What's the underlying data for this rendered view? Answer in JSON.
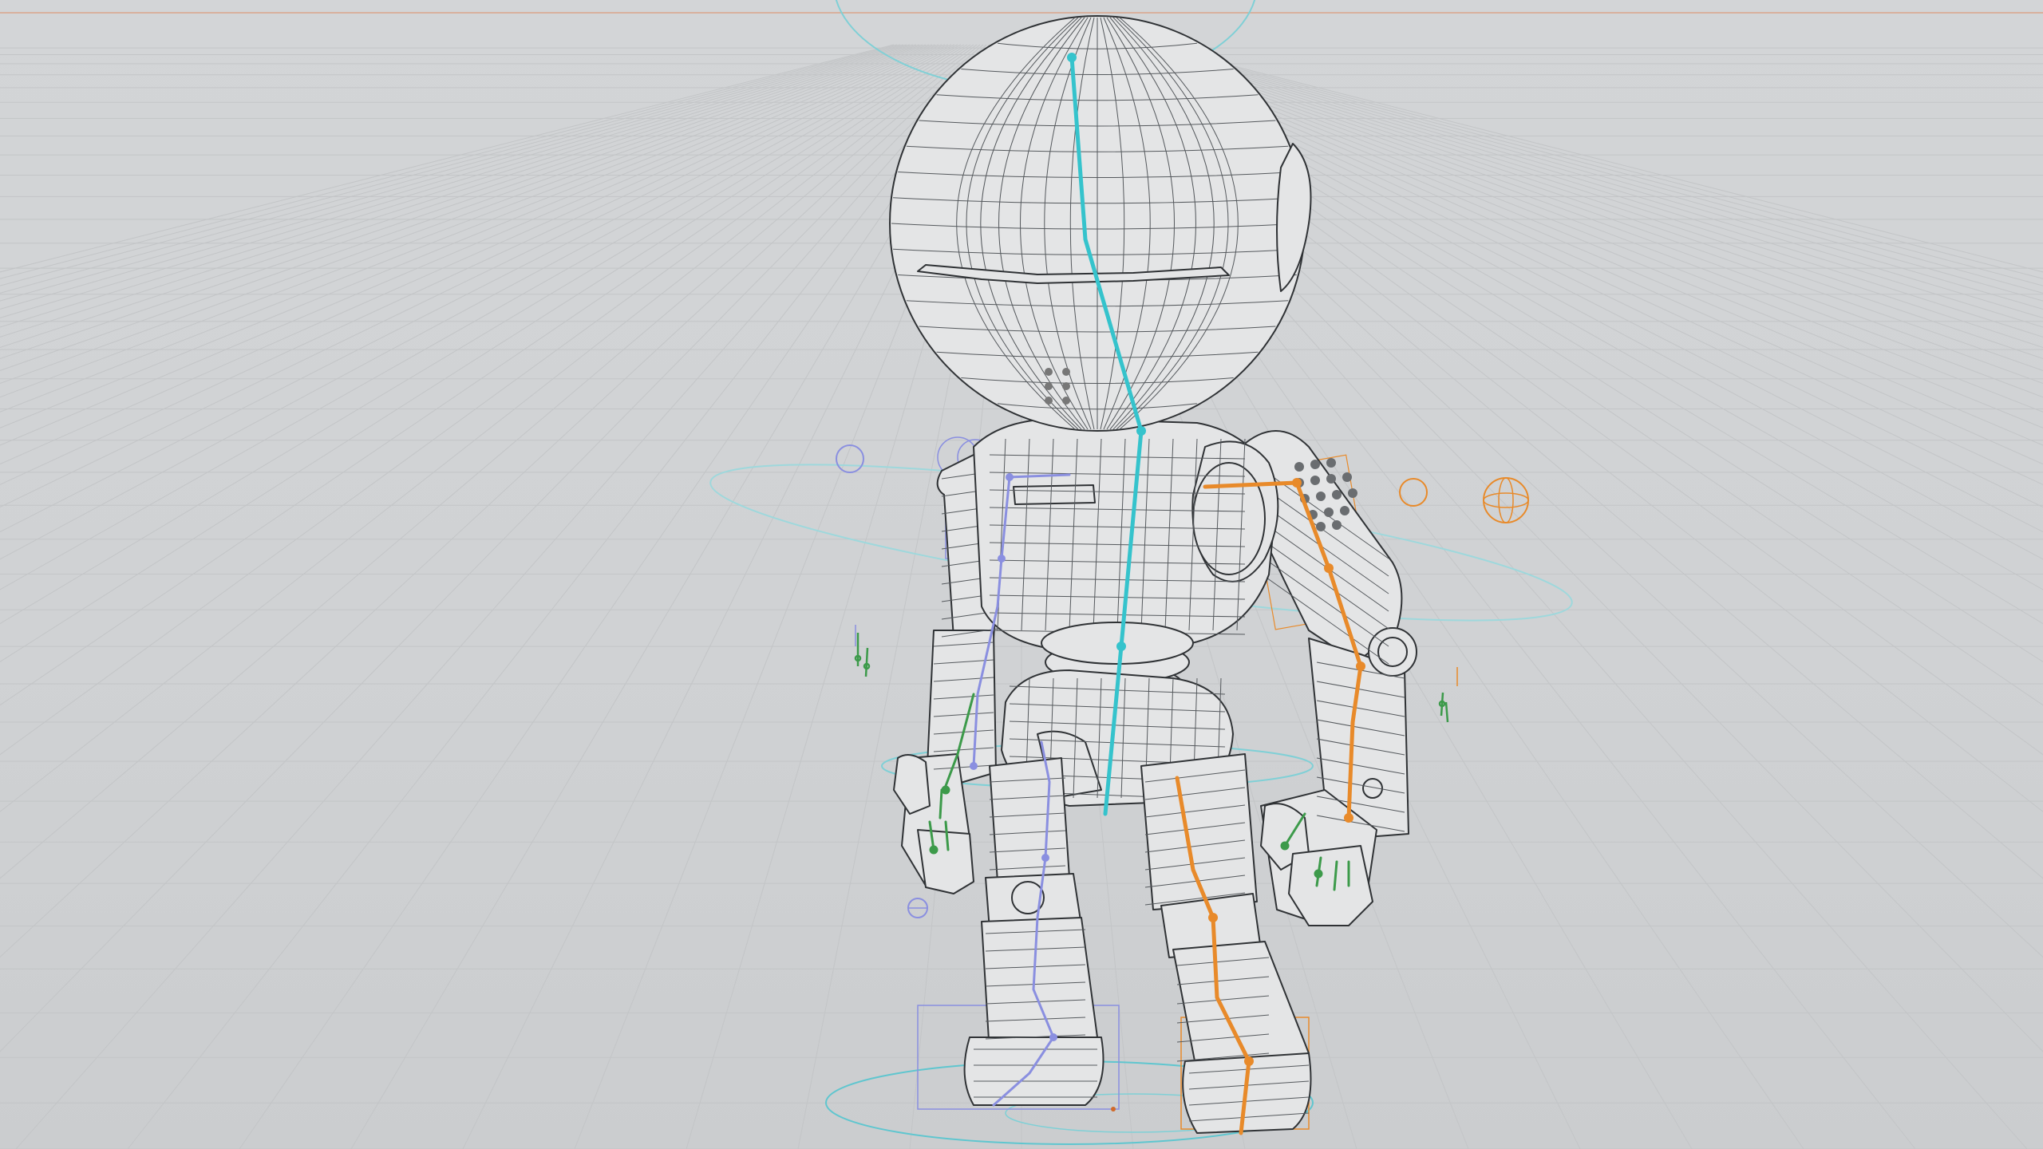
{
  "viewport": {
    "view": "perspective",
    "shading": "wireframe-on-shaded",
    "background_color": "#cfd1d3",
    "grid": true
  },
  "scene": {
    "object": "robot-character",
    "rig_colors": {
      "spine": "#35c3cc",
      "left_side": "#e88a2a",
      "right_side": "#8a8fe0",
      "fingers": "#3c9a4a",
      "control_curves": "#7fd0d6"
    },
    "joint_icons": [
      "ik-handle-icon",
      "ik-handle-icon"
    ]
  }
}
